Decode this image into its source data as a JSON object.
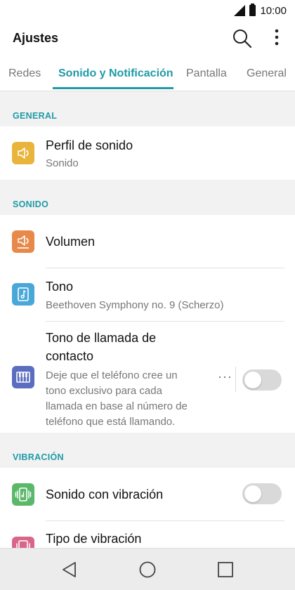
{
  "status": {
    "time": "10:00"
  },
  "appbar": {
    "title": "Ajustes"
  },
  "tabs": [
    {
      "label": "Redes"
    },
    {
      "label": "Sonido y Notificación"
    },
    {
      "label": "Pantalla"
    },
    {
      "label": "General"
    }
  ],
  "sections": {
    "general": "GENERAL",
    "sonido": "SONIDO",
    "vibracion": "VIBRACIÓN"
  },
  "items": {
    "perfil": {
      "title": "Perfil de sonido",
      "subtitle": "Sonido"
    },
    "volumen": {
      "title": "Volumen"
    },
    "tono": {
      "title": "Tono",
      "subtitle": "Beethoven Symphony no. 9 (Scherzo)"
    },
    "tono_contacto": {
      "title_line1": "Tono de llamada de",
      "title_line2": "contacto",
      "sub_line1": "Deje que el teléfono cree un",
      "sub_line2": "tono exclusivo para cada",
      "sub_line3": "llamada en base al número de",
      "sub_line4": "teléfono que está llamando.",
      "more": "···"
    },
    "sonido_vibracion": {
      "title": "Sonido con vibración"
    },
    "tipo_vibracion": {
      "title": "Tipo de vibración"
    }
  },
  "icons": {
    "perfil": "speaker-icon",
    "volumen": "volume-icon",
    "tono": "music-note-icon",
    "tono_contacto": "piano-icon",
    "sonido_vibracion": "vibrate-icon",
    "tipo_vibracion": "vibration-type-icon"
  },
  "colors": {
    "accent": "#1f9aa8",
    "perfil_icon": "#e8b43c",
    "volumen_icon": "#e8894a",
    "tono_icon": "#4aa8d8",
    "contacto_icon": "#5b6dbf",
    "vibracion_icon": "#5bb86a",
    "tipo_icon": "#d9668a"
  },
  "toggles": {
    "tono_contacto": false,
    "sonido_vibracion": false
  }
}
